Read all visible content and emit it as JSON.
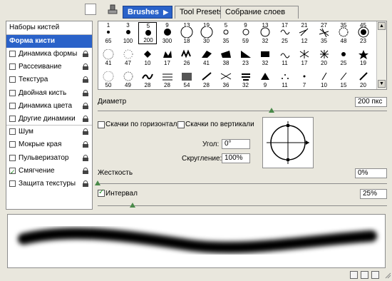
{
  "tabs": [
    {
      "label": "Brushes",
      "active": true
    },
    {
      "label": "Tool Presets",
      "active": false
    },
    {
      "label": "Собрание слоев",
      "active": false
    }
  ],
  "left_panel": {
    "header": "Наборы кистей",
    "selected": "Форма кисти",
    "items": [
      {
        "label": "Динамика формы",
        "checked": false
      },
      {
        "label": "Рассеивание",
        "checked": false
      },
      {
        "label": "Текстура",
        "checked": false
      },
      {
        "label": "Двойная кисть",
        "checked": false
      },
      {
        "label": "Динамика цвета",
        "checked": false
      },
      {
        "label": "Другие динамики",
        "checked": false
      },
      {
        "label": "Шум",
        "checked": false
      },
      {
        "label": "Мокрые края",
        "checked": false
      },
      {
        "label": "Пульверизатор",
        "checked": false
      },
      {
        "label": "Смягчение",
        "checked": true
      },
      {
        "label": "Защита текстуры",
        "checked": false
      }
    ]
  },
  "brushes": [
    {
      "top": "1",
      "bot": "65"
    },
    {
      "top": "3",
      "bot": "100"
    },
    {
      "top": "5",
      "bot": "200"
    },
    {
      "top": "9",
      "bot": "300"
    },
    {
      "top": "13",
      "bot": "18"
    },
    {
      "top": "19",
      "bot": "30"
    },
    {
      "top": "5",
      "bot": "35"
    },
    {
      "top": "9",
      "bot": "59"
    },
    {
      "top": "13",
      "bot": "32"
    },
    {
      "top": "17",
      "bot": "25"
    },
    {
      "top": "21",
      "bot": "12"
    },
    {
      "top": "27",
      "bot": "35"
    },
    {
      "top": "35",
      "bot": "48"
    },
    {
      "top": "45",
      "bot": "23"
    },
    {
      "top": "",
      "bot": "41"
    },
    {
      "top": "",
      "bot": "47"
    },
    {
      "top": "",
      "bot": "10"
    },
    {
      "top": "",
      "bot": "17"
    },
    {
      "top": "",
      "bot": "26"
    },
    {
      "top": "",
      "bot": "41"
    },
    {
      "top": "",
      "bot": "38"
    },
    {
      "top": "",
      "bot": "23"
    },
    {
      "top": "",
      "bot": "32"
    },
    {
      "top": "",
      "bot": "11"
    },
    {
      "top": "",
      "bot": "17"
    },
    {
      "top": "",
      "bot": "20"
    },
    {
      "top": "",
      "bot": "25"
    },
    {
      "top": "",
      "bot": "19"
    },
    {
      "top": "",
      "bot": "50"
    },
    {
      "top": "",
      "bot": "49"
    },
    {
      "top": "",
      "bot": "28"
    },
    {
      "top": "",
      "bot": "28"
    },
    {
      "top": "",
      "bot": "54"
    },
    {
      "top": "",
      "bot": "28"
    },
    {
      "top": "",
      "bot": "36"
    },
    {
      "top": "",
      "bot": "32"
    },
    {
      "top": "",
      "bot": "9"
    },
    {
      "top": "",
      "bot": "11"
    },
    {
      "top": "",
      "bot": "7"
    },
    {
      "top": "",
      "bot": "10"
    },
    {
      "top": "",
      "bot": "15"
    },
    {
      "top": "",
      "bot": "20"
    }
  ],
  "diameter": {
    "label": "Диаметр",
    "value": "200 пкс",
    "fraction": 0.6
  },
  "flip_x": {
    "label": "Скачки по горизонтали",
    "checked": false
  },
  "flip_y": {
    "label": "Скачки по вертикали",
    "checked": false
  },
  "angle": {
    "label": "Угол:",
    "value": "0°"
  },
  "roundness": {
    "label": "Скругление:",
    "value": "100%"
  },
  "hardness": {
    "label": "Жесткость",
    "value": "0%",
    "fraction": 0.0
  },
  "spacing": {
    "label": "Интервал",
    "value": "25%",
    "checked": true,
    "fraction": 0.12
  },
  "icons": {
    "top_left_1": "brush-preset-icon",
    "top_left_2": "stamp-icon",
    "bottom_1": "save-icon",
    "bottom_2": "new-icon",
    "bottom_3": "trash-icon"
  }
}
